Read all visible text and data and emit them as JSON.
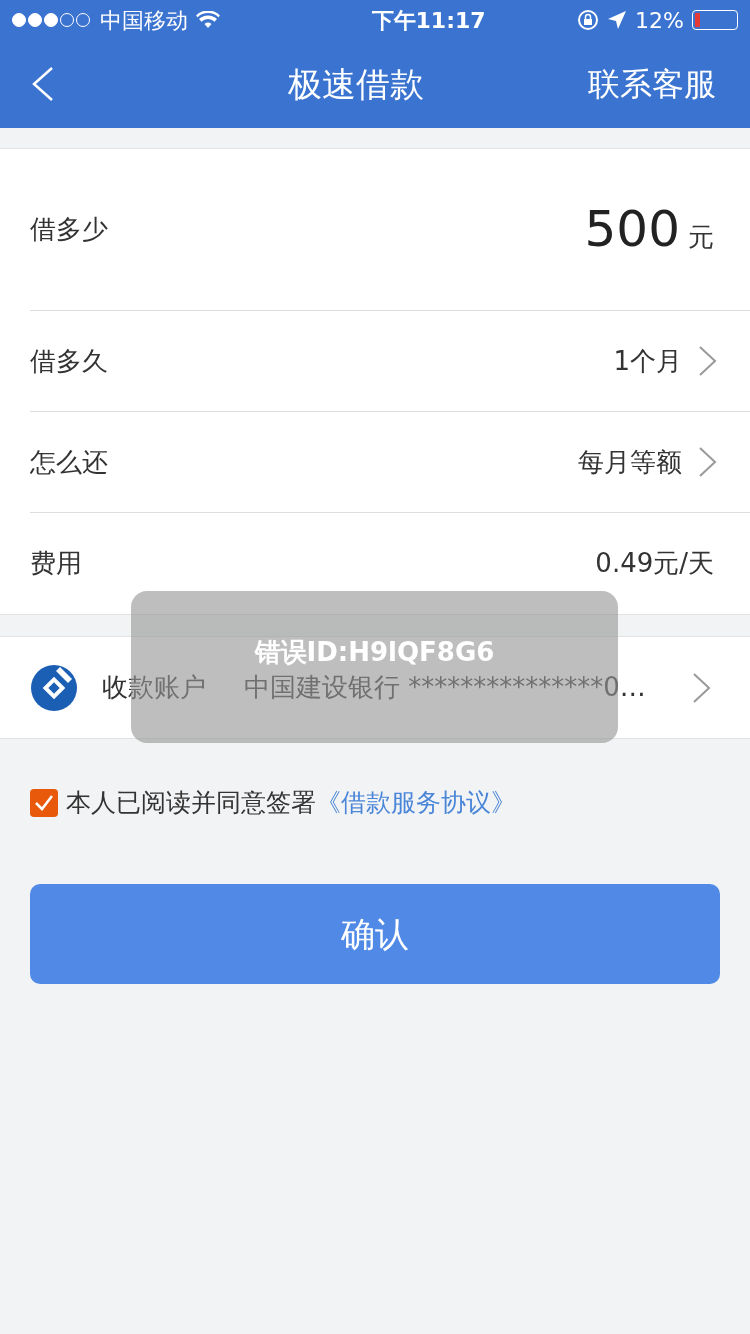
{
  "status_bar": {
    "signal_dots": [
      {
        "filled": true
      },
      {
        "filled": true
      },
      {
        "filled": true
      },
      {
        "filled": false
      },
      {
        "filled": false
      }
    ],
    "carrier": "中国移动",
    "time": "下午11:17",
    "battery_text": "12%",
    "battery": {
      "level": 0.12
    }
  },
  "nav": {
    "title": "极速借款",
    "action": "联系客服"
  },
  "amount": {
    "label": "借多少",
    "value": "500",
    "unit": "元"
  },
  "rows": [
    {
      "label": "借多久",
      "value": "1个月",
      "kind": "link"
    },
    {
      "label": "怎么还",
      "value": "每月等额",
      "kind": "link"
    },
    {
      "label": "费用",
      "value": "0.49元/天",
      "kind": "plain"
    }
  ],
  "account": {
    "label": "收款账户",
    "value": "中国建设银行 ***************0…"
  },
  "agreement": {
    "checked": true,
    "text": "本人已阅读并同意签署",
    "link": "《借款服务协议》"
  },
  "confirm_button": "确认",
  "toast": {
    "title": "错误ID:H9lQF8G6"
  }
}
